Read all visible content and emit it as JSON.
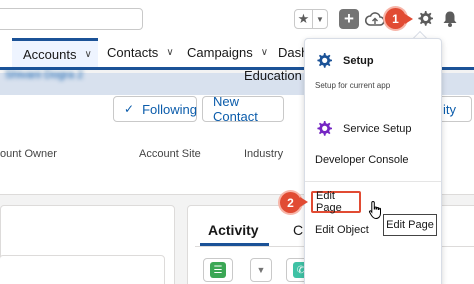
{
  "header": {
    "icons": [
      "star-icon",
      "chevron-down-icon",
      "plus-icon",
      "cloud-icon",
      "gear-icon",
      "bell-icon"
    ]
  },
  "annotations": {
    "step1": "1",
    "step2": "2"
  },
  "nav": {
    "items": [
      {
        "label": "Accounts"
      },
      {
        "label": "Contacts"
      },
      {
        "label": "Campaigns"
      },
      {
        "label": "Dashb"
      }
    ]
  },
  "record": {
    "following_label": "Following",
    "new_contact_label": "New Contact",
    "more_label": "ity",
    "fields": {
      "owner_label": "ount Owner",
      "owner_value": "Shivani Dogra 2",
      "site_label": "Account Site",
      "industry_label": "Industry",
      "industry_value": "Education"
    }
  },
  "tabs": {
    "activity": "Activity",
    "chatter": "Ch"
  },
  "setup_menu": {
    "setup_title": "Setup",
    "setup_subtitle": "Setup for current app",
    "service_setup": "Service Setup",
    "developer_console": "Developer Console",
    "edit_page": "Edit Page",
    "edit_object": "Edit Object"
  },
  "tooltip": "Edit Page",
  "colors": {
    "brand_blue": "#1b5297",
    "link_blue": "#0b5cab",
    "annotation_red": "#e14b33",
    "setup_gear_blue": "#1b5297",
    "service_gear_purple": "#7526c3"
  }
}
